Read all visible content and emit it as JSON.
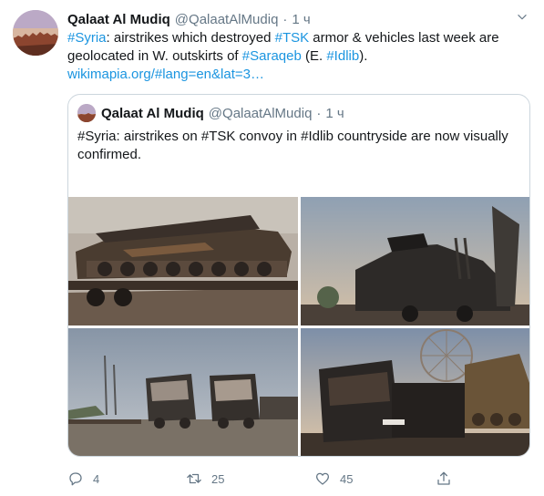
{
  "tweet": {
    "author_name": "Qalaat Al Mudiq",
    "author_handle": "@QalaatAlMudiq",
    "separator": "·",
    "time": "1 ч",
    "text": {
      "hash_syria": "#Syria",
      "part1": ": airstrikes which destroyed ",
      "hash_tsk": "#TSK",
      "part2": " armor & vehicles last week are geolocated in W. outskirts of ",
      "hash_saraqeb": "#Saraqeb",
      "part3": " (E. ",
      "hash_idlib": "#Idlib",
      "part4": ").",
      "url": "wikimapia.org/#lang=en&lat=3…"
    }
  },
  "quoted_tweet": {
    "author_name": "Qalaat Al Mudiq",
    "author_handle": "@QalaatAlMudiq",
    "separator": "·",
    "time": "1 ч",
    "text": "#Syria: airstrikes on #TSK convoy in #Idlib countryside are now visually confirmed."
  },
  "actions": {
    "reply_count": "4",
    "retweet_count": "25",
    "like_count": "45",
    "share_count": ""
  },
  "icons": {
    "more": "chevron-down-icon",
    "reply": "reply-icon",
    "retweet": "retweet-icon",
    "like": "heart-icon",
    "share": "share-icon"
  },
  "colors": {
    "link": "#1b95e0",
    "secondary_text": "#657786",
    "primary_text": "#14171a",
    "border": "#ccd6dd"
  }
}
